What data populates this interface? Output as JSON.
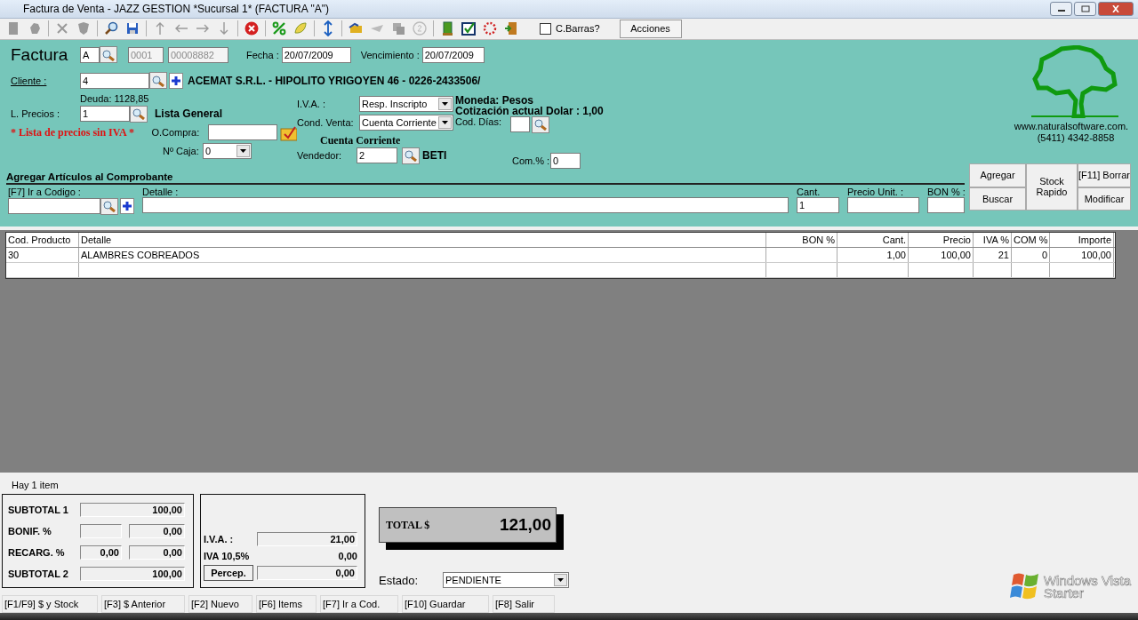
{
  "window": {
    "title": "Factura de Venta - JAZZ GESTION *Sucursal 1* (FACTURA \"A\")"
  },
  "toolbar": {
    "barcode": {
      "label": "C.Barras?",
      "checked": false
    },
    "actions": "Acciones"
  },
  "header": {
    "title": "Factura",
    "letter": "A",
    "point_of_sale": "0001",
    "number": "00008882",
    "date_label": "Fecha :",
    "date": "20/07/2009",
    "due_label": "Vencimiento :",
    "due": "20/07/2009"
  },
  "client": {
    "label": "Cliente :",
    "code": "4",
    "name": "ACEMAT S.R.L. - HIPOLITO YRIGOYEN 46 - 0226-2433506/",
    "debt": "Deuda: 1128,85"
  },
  "price_list": {
    "label": "L. Precios :",
    "value": "1",
    "name": "Lista General",
    "warning": "* Lista de precios sin IVA *"
  },
  "purchase_order": {
    "label": "O.Compra:"
  },
  "cash_box": {
    "label": "Nº Caja:",
    "value": "0"
  },
  "iva": {
    "label": "I.V.A. :",
    "value": "Resp. Inscripto"
  },
  "sale_condition": {
    "label": "Cond. Venta:",
    "value": "Cuenta Corriente",
    "caption": "Cuenta Corriente"
  },
  "seller": {
    "label": "Vendedor:",
    "value": "2",
    "name": "BETI"
  },
  "currency": {
    "text": "Moneda: Pesos",
    "rate": "Cotización actual Dolar : 1,00"
  },
  "days": {
    "label": "Cod. Días:"
  },
  "commission": {
    "label": "Com.% :",
    "value": "0"
  },
  "company": {
    "website": "www.naturalsoftware.com.",
    "phone": "(5411) 4342-8858"
  },
  "add_items": {
    "title": "Agregar Artículos al Comprobante",
    "code_label": "[F7] Ir a Codigo :",
    "detail_label": "Detalle :",
    "qty_label": "Cant.",
    "qty": "1",
    "price_label": "Precio Unit. :",
    "discount_label": "BON % :",
    "buttons": [
      "Agregar",
      "Buscar",
      "Stock Rapido",
      "[F11] Borrar",
      "Modificar"
    ]
  },
  "table": {
    "columns": [
      "Cod. Producto",
      "Detalle",
      "BON %",
      "Cant.",
      "Precio",
      "IVA %",
      "COM %",
      "Importe"
    ],
    "rows": [
      [
        "30",
        "ALAMBRES COBREADOS",
        "",
        "1,00",
        "100,00",
        "21",
        "0",
        "100,00"
      ]
    ]
  },
  "status": "Hay 1 item",
  "totals": {
    "subtotal1": {
      "label": "SUBTOTAL 1",
      "value": "100,00"
    },
    "discount": {
      "label": "BONIF. %",
      "value": "0,00"
    },
    "surcharge": {
      "label": "RECARG. %",
      "percent": "0,00",
      "value": "0,00"
    },
    "subtotal2": {
      "label": "SUBTOTAL 2",
      "value": "100,00"
    }
  },
  "taxes": {
    "iva": {
      "label": "I.V.A. :",
      "value": "21,00"
    },
    "iva105": {
      "label": "IVA 10,5%",
      "value": "0,00"
    },
    "perception": {
      "label": "Percep.",
      "value": "0,00"
    }
  },
  "total": {
    "label": "TOTAL $",
    "value": "121,00"
  },
  "state": {
    "label": "Estado:",
    "value": "PENDIENTE"
  },
  "os_watermark": {
    "line1": "Windows Vista",
    "line2": "Starter"
  },
  "function_keys": [
    "[F1/F9] $ y Stock",
    "[F3] $ Anterior",
    "[F2] Nuevo",
    "[F6] Items",
    "[F7] Ir a Cod.",
    "[F10] Guardar",
    "[F8] Salir"
  ]
}
